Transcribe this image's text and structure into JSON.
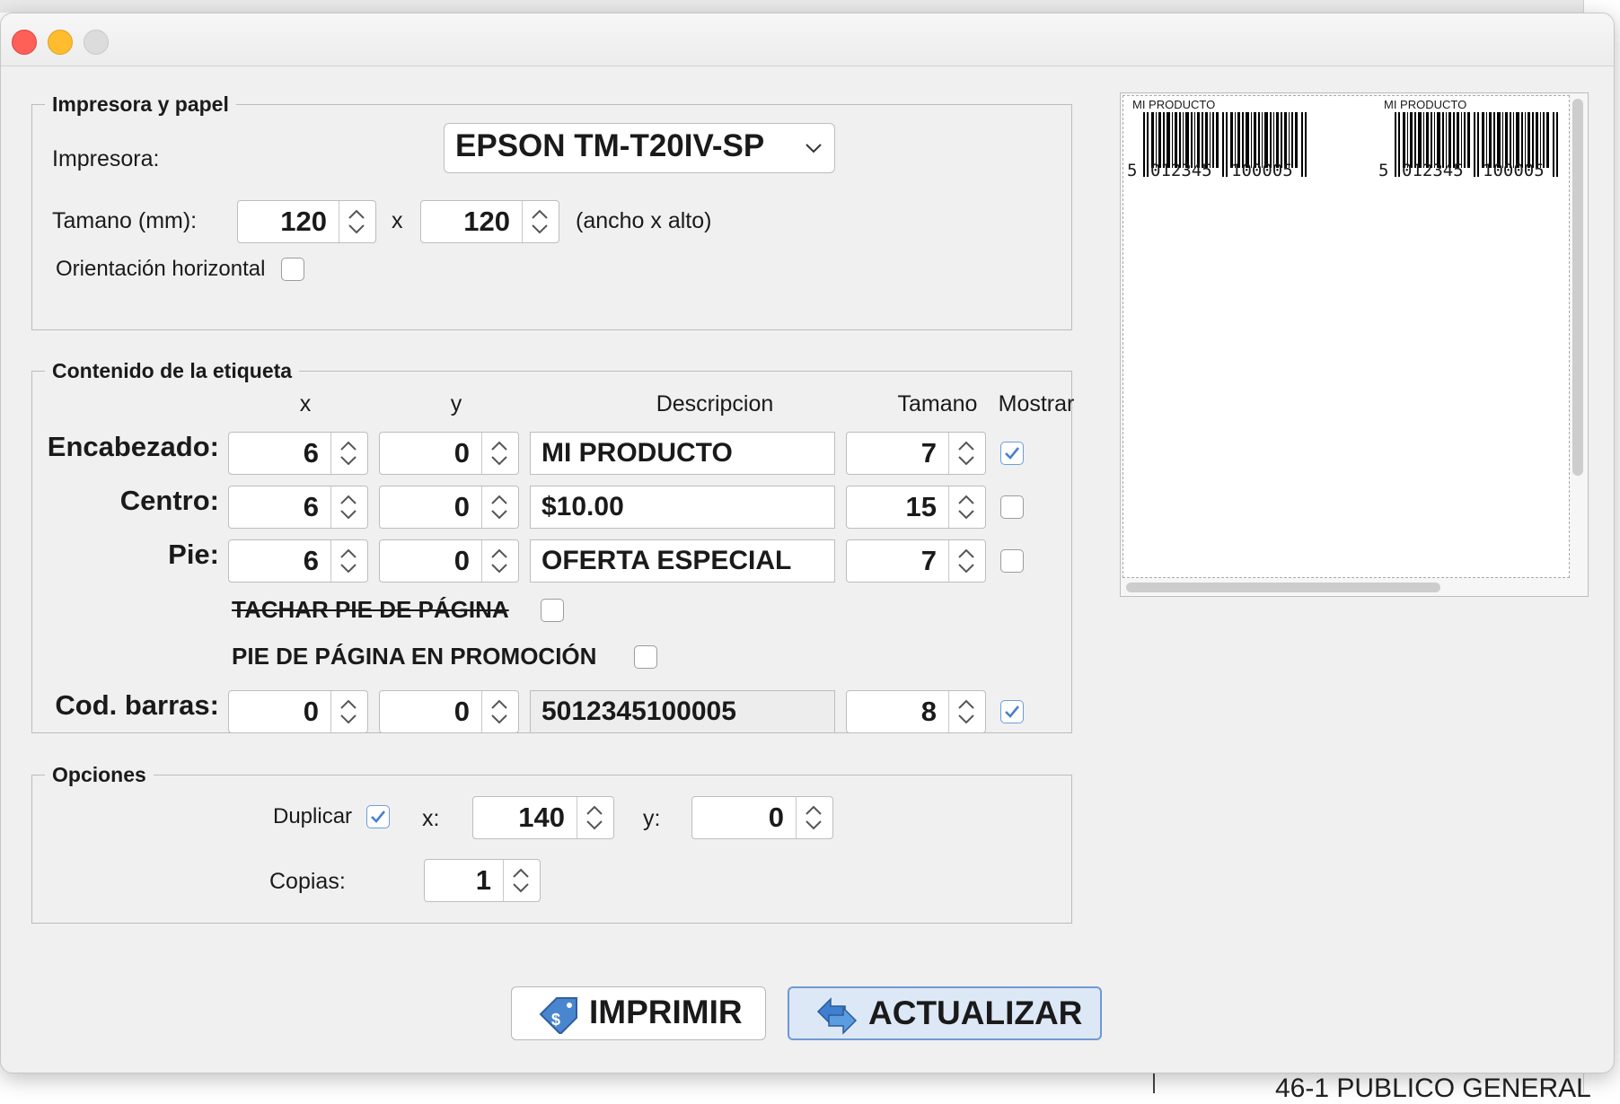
{
  "background": {
    "partial_text": "46-1 PUBLICO GENERAL"
  },
  "printer_group": {
    "title": "Impresora y papel",
    "printer_label": "Impresora:",
    "printer_value": "EPSON TM-T20IV-SP",
    "size_label": "Tamano (mm):",
    "width": "120",
    "times": "x",
    "height": "120",
    "size_hint": "(ancho x alto)",
    "orientation_label": "Orientación horizontal",
    "orientation_checked": false
  },
  "content_group": {
    "title": "Contenido de la etiqueta",
    "headers": {
      "x": "x",
      "y": "y",
      "description": "Descripcion",
      "size": "Tamano",
      "show": "Mostrar"
    },
    "rows": [
      {
        "label": "Encabezado:",
        "x": "6",
        "y": "0",
        "description": "MI PRODUCTO",
        "size": "7",
        "show": true
      },
      {
        "label": "Centro:",
        "x": "6",
        "y": "0",
        "description": "$10.00",
        "size": "15",
        "show": false
      },
      {
        "label": "Pie:",
        "x": "6",
        "y": "0",
        "description": "OFERTA ESPECIAL",
        "size": "7",
        "show": false
      }
    ],
    "strike_footer_label": "TACHAR PIE DE PÁGINA",
    "promo_footer_label": "PIE DE PÁGINA EN PROMOCIÓN",
    "barcode_row": {
      "label": "Cod. barras:",
      "x": "0",
      "y": "0",
      "value": "5012345100005",
      "size": "8",
      "show": true
    }
  },
  "options_group": {
    "title": "Opciones",
    "duplicate_label": "Duplicar",
    "duplicate_checked": true,
    "x_label": "x:",
    "x_value": "140",
    "y_label": "y:",
    "y_value": "0",
    "copies_label": "Copias:",
    "copies_value": "1"
  },
  "preview": {
    "label_title": "MI PRODUCTO",
    "barcode_left": "5",
    "barcode_mid": "012345",
    "barcode_right": "100005"
  },
  "buttons": {
    "print": "IMPRIMIR",
    "refresh": "ACTUALIZAR"
  },
  "colors": {
    "window_bg": "#f0f0f0",
    "check_accent": "#4a7fd0",
    "primary_button_bg": "#dde8f7"
  }
}
